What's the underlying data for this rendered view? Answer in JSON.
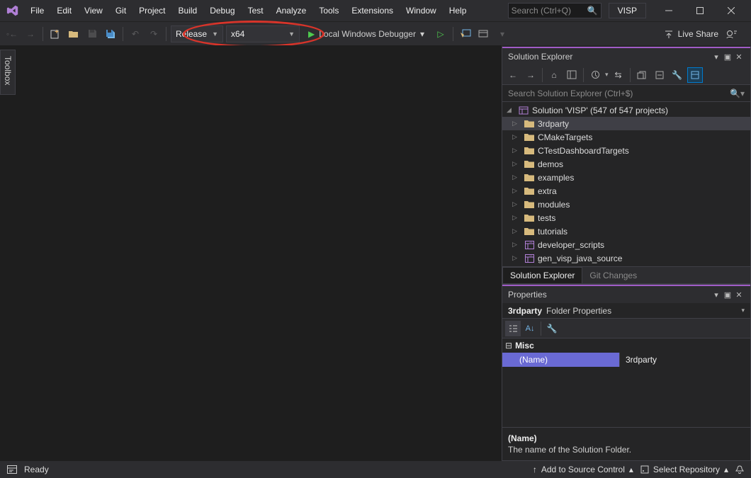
{
  "menu": [
    "File",
    "Edit",
    "View",
    "Git",
    "Project",
    "Build",
    "Debug",
    "Test",
    "Analyze",
    "Tools",
    "Extensions",
    "Window",
    "Help"
  ],
  "search_placeholder": "Search (Ctrl+Q)",
  "solution_name_badge": "VISP",
  "toolbar": {
    "config": "Release",
    "platform": "x64",
    "debugger_label": "Local Windows Debugger",
    "live_share": "Live Share"
  },
  "toolbox_tab": "Toolbox",
  "solution_explorer": {
    "title": "Solution Explorer",
    "search_placeholder": "Search Solution Explorer (Ctrl+$)",
    "root": "Solution 'VISP' (547 of 547 projects)",
    "nodes": [
      {
        "label": "3rdparty",
        "icon": "folder",
        "selected": true
      },
      {
        "label": "CMakeTargets",
        "icon": "folder"
      },
      {
        "label": "CTestDashboardTargets",
        "icon": "folder"
      },
      {
        "label": "demos",
        "icon": "folder"
      },
      {
        "label": "examples",
        "icon": "folder"
      },
      {
        "label": "extra",
        "icon": "folder"
      },
      {
        "label": "modules",
        "icon": "folder"
      },
      {
        "label": "tests",
        "icon": "folder"
      },
      {
        "label": "tutorials",
        "icon": "folder"
      },
      {
        "label": "developer_scripts",
        "icon": "project"
      },
      {
        "label": "gen_visp_java_source",
        "icon": "project"
      }
    ],
    "tabs": [
      "Solution Explorer",
      "Git Changes"
    ]
  },
  "properties": {
    "title": "Properties",
    "object_name": "3rdparty",
    "object_type": "Folder Properties",
    "category": "Misc",
    "row_key": "(Name)",
    "row_val": "3rdparty",
    "desc_title": "(Name)",
    "desc_body": "The name of the Solution Folder."
  },
  "statusbar": {
    "ready": "Ready",
    "add_src": "Add to Source Control",
    "select_repo": "Select Repository"
  }
}
